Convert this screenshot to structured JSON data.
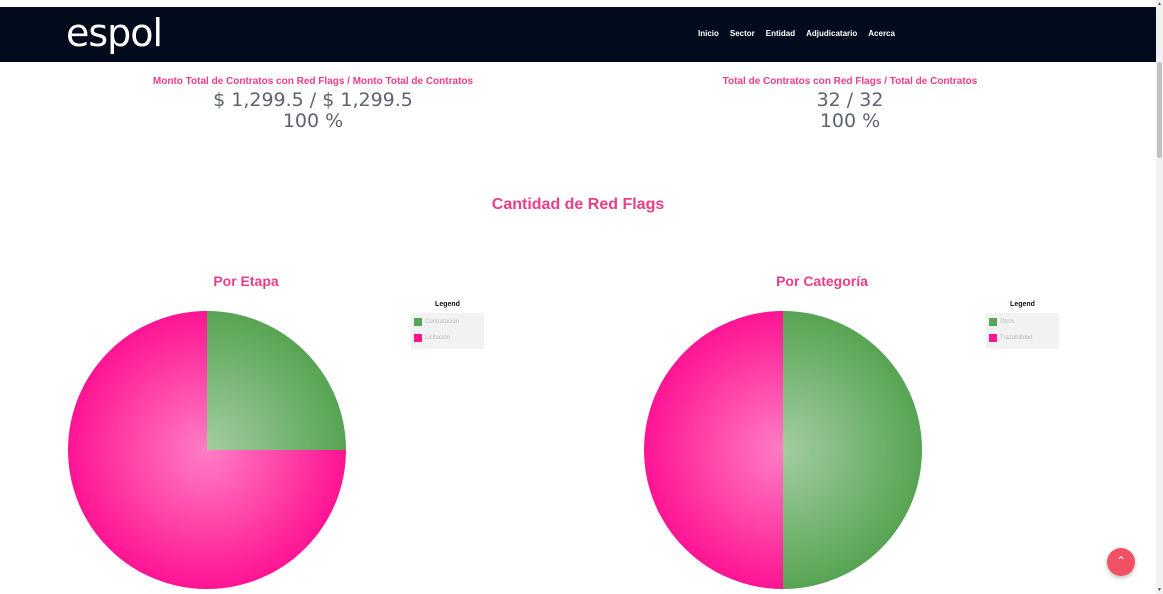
{
  "navbar": {
    "logo": "espol",
    "links": [
      "Inicio",
      "Sector",
      "Entidad",
      "Adjudicatario",
      "Acerca"
    ]
  },
  "stats": {
    "amount": {
      "title": "Monto Total de Contratos con Red Flags / Monto Total de Contratos",
      "value": "$ 1,299.5 / $ 1,299.5",
      "percent": "100 %"
    },
    "count": {
      "title": "Total de Contratos con Red Flags / Total de Contratos",
      "value": "32 / 32",
      "percent": "100 %"
    }
  },
  "section_title": "Cantidad de Red Flags",
  "colors": {
    "accent": "#ec3d8a",
    "green": "#57a453",
    "pink": "#ff1493",
    "navbar": "#020b1c",
    "fab": "#f25163"
  },
  "chart_data": [
    {
      "type": "pie",
      "title": "Por Etapa",
      "legend_title": "Legend",
      "legend_position": "top-right",
      "labels": [
        "Contratación",
        "Licitación"
      ],
      "values": [
        25,
        75
      ],
      "colors": [
        "#57a453",
        "#ff1493"
      ]
    },
    {
      "type": "pie",
      "title": "Por Categoría",
      "legend_title": "Legend",
      "legend_position": "top-right",
      "labels": [
        "Otros",
        "Trazabilidad"
      ],
      "values": [
        50,
        50
      ],
      "colors": [
        "#57a453",
        "#ff1493"
      ]
    }
  ],
  "fab_icon": "chevron-up-icon"
}
